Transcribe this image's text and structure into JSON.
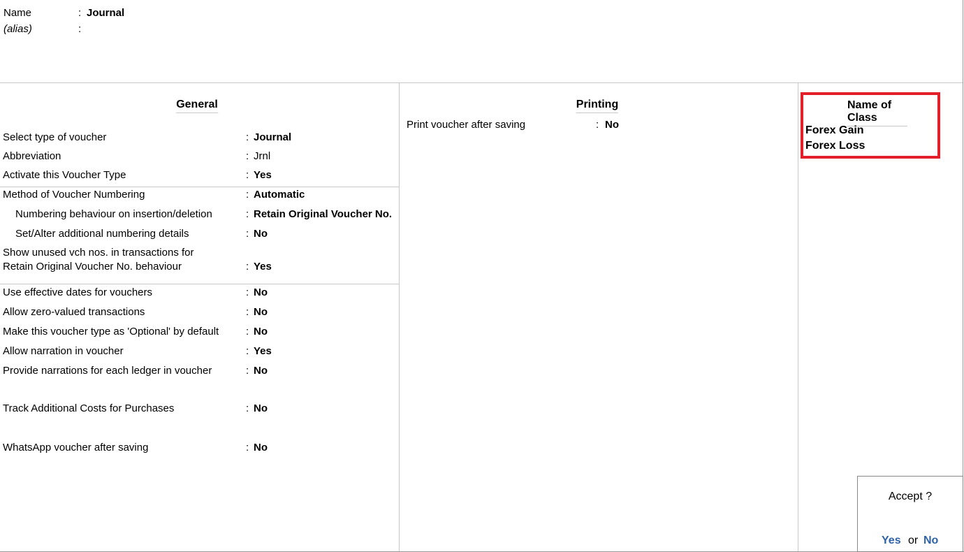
{
  "header": {
    "name_label": "Name",
    "name_value": "Journal",
    "alias_label": "(alias)",
    "colon": ":"
  },
  "general": {
    "title": "General",
    "rows": [
      {
        "label": "Select type of voucher",
        "value": "Journal"
      },
      {
        "label": "Abbreviation",
        "value": "Jrnl"
      },
      {
        "label": "Activate this Voucher Type",
        "value": "Yes"
      },
      {
        "label": "Method of Voucher Numbering",
        "value": "Automatic"
      },
      {
        "label": "Numbering behaviour on insertion/deletion",
        "value": "Retain Original Voucher No."
      },
      {
        "label": "Set/Alter additional numbering details",
        "value": "No"
      },
      {
        "label": "Show unused vch nos. in transactions for",
        "label2": "Retain Original Voucher No. behaviour",
        "value": "Yes"
      },
      {
        "label": "Use effective dates for vouchers",
        "value": "No"
      },
      {
        "label": "Allow zero-valued transactions",
        "value": "No"
      },
      {
        "label": "Make this voucher type as 'Optional' by default",
        "value": "No"
      },
      {
        "label": "Allow narration in voucher",
        "value": "Yes"
      },
      {
        "label": "Provide narrations for each ledger in voucher",
        "value": "No"
      },
      {
        "label": "Track Additional Costs for Purchases",
        "value": "No"
      },
      {
        "label": "WhatsApp voucher after saving",
        "value": "No"
      }
    ]
  },
  "printing": {
    "title": "Printing",
    "rows": [
      {
        "label": "Print voucher after saving",
        "value": "No"
      }
    ]
  },
  "class": {
    "title": "Name of Class",
    "items": [
      "Forex Gain",
      "Forex Loss"
    ],
    "highlight_color": "#e3202a"
  },
  "accept": {
    "question": "Accept ?",
    "yes": "Yes",
    "or": "or",
    "no": "No",
    "accent": "#2e63a8"
  }
}
